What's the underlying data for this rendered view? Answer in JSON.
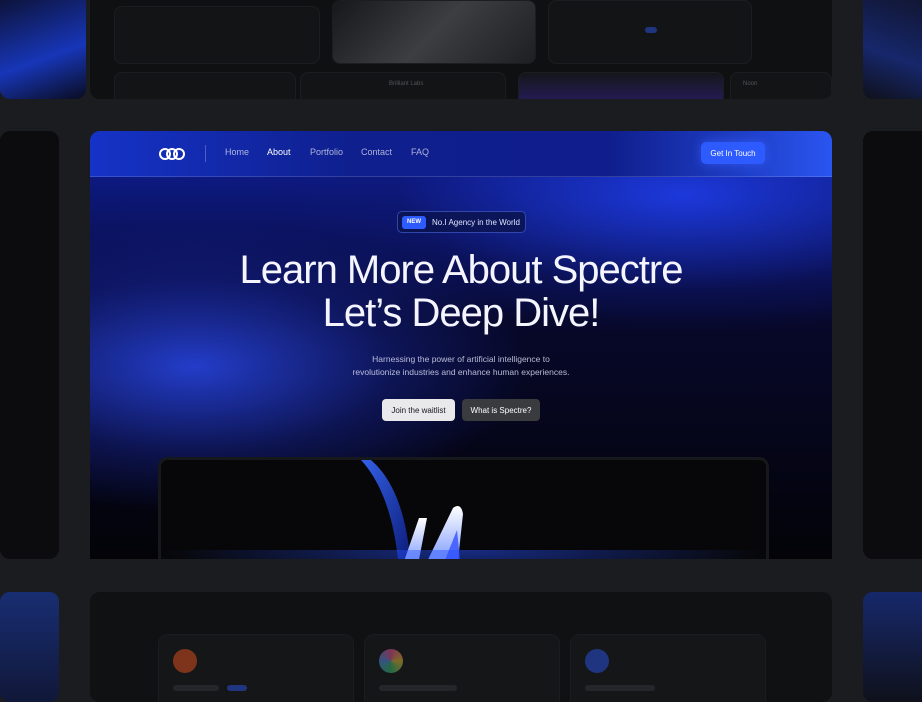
{
  "hero": {
    "nav": {
      "logo_icon": "infinity-logo-icon",
      "items": [
        "Home",
        "About",
        "Portfolio",
        "Contact",
        "FAQ"
      ],
      "active": "About",
      "cta": "Get In Touch"
    },
    "badge": {
      "pill": "NEW",
      "text": "No.I Agency in the World"
    },
    "headline": [
      "Learn More About Spectre",
      "Let’s Deep Dive!"
    ],
    "subtitle": [
      "Harnessing the power of artificial intelligence to",
      "revolutionize industries and enhance human experiences."
    ],
    "buttons": {
      "primary": "Join the waitlist",
      "secondary": "What is Spectre?"
    }
  },
  "background": {
    "top_tiles": {
      "brilliant_labs": "Brilliant Labs",
      "noon": "Noon"
    }
  },
  "colors": {
    "accent": "#2e5bff",
    "hero_top": "#1533c7",
    "page_bg": "#1b1c1f"
  }
}
